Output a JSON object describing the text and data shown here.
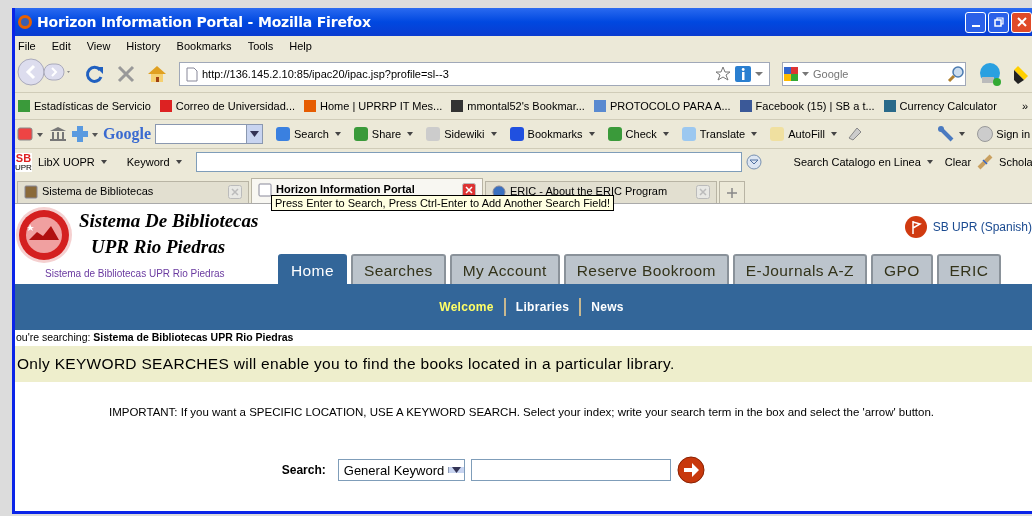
{
  "window": {
    "title": "Horizon Information Portal - Mozilla Firefox"
  },
  "menu": [
    "File",
    "Edit",
    "View",
    "History",
    "Bookmarks",
    "Tools",
    "Help"
  ],
  "address": {
    "value": "http://136.145.2.10:85/ipac20/ipac.jsp?profile=sl--3"
  },
  "web_search": {
    "placeholder": "Google"
  },
  "bookmarks": [
    {
      "label": "Estadísticas de Servicio"
    },
    {
      "label": "Correo de Universidad..."
    },
    {
      "label": "Home | UPRRP IT Mes..."
    },
    {
      "label": "mmontal52's Bookmar..."
    },
    {
      "label": "PROTOCOLO PARA A..."
    },
    {
      "label": "Facebook (15) | SB a t..."
    },
    {
      "label": "Currency Calculator"
    }
  ],
  "bookmarks_more": "»",
  "google_toolbar": {
    "logo": "Google",
    "items": [
      {
        "label": "Search"
      },
      {
        "label": "Share"
      },
      {
        "label": "Sidewiki"
      },
      {
        "label": "Bookmarks"
      },
      {
        "label": "Check"
      },
      {
        "label": "Translate"
      },
      {
        "label": "AutoFill"
      }
    ],
    "sign_in": "Sign in"
  },
  "libx": {
    "badge_top": "SB",
    "badge_bottom": "UPR",
    "name": "LibX UOPR",
    "type": "Keyword",
    "action": "Search Catalogo en Linea",
    "clear": "Clear",
    "scholar": "Schola"
  },
  "browser_tabs": [
    {
      "label": "Sistema de Bibliotecas",
      "selected": false
    },
    {
      "label": "Horizon Information Portal",
      "selected": true
    },
    {
      "label": "ERIC - About the ERIC Program",
      "selected": false
    }
  ],
  "tooltip": "Press Enter to Search, Press Ctrl-Enter to Add Another Search Field!",
  "site": {
    "title_lines": [
      "Sistema De Bibliotecas",
      "UPR Rio Piedras"
    ],
    "subtitle": "Sistema de Bibliotecas UPR Rio Piedras",
    "language_link": "SB UPR (Spanish)",
    "tabs": [
      {
        "label": "Home",
        "selected": true
      },
      {
        "label": "Searches",
        "selected": false
      },
      {
        "label": "My Account",
        "selected": false
      },
      {
        "label": "Reserve Bookroom",
        "selected": false
      },
      {
        "label": "E-Journals A-Z",
        "selected": false
      },
      {
        "label": "GPO",
        "selected": false
      },
      {
        "label": "ERIC",
        "selected": false
      }
    ],
    "subnav": [
      {
        "label": "Welcome",
        "selected": true
      },
      {
        "label": "Libraries",
        "selected": false
      },
      {
        "label": "News",
        "selected": false
      }
    ]
  },
  "searching": "ou're searching: **Sistema de Bibliotecas UPR Rio Piedras**",
  "notice": "Only KEYWORD SEARCHES will enable you to find the books located in a particular library.",
  "important": "IMPORTANT: If you want a SPECIFIC LOCATION, USE A KEYWORD SEARCH. Select your index; write your search term in the box and select the 'arrow' button.",
  "search_form": {
    "label": "Search:",
    "index": "General Keyword"
  }
}
